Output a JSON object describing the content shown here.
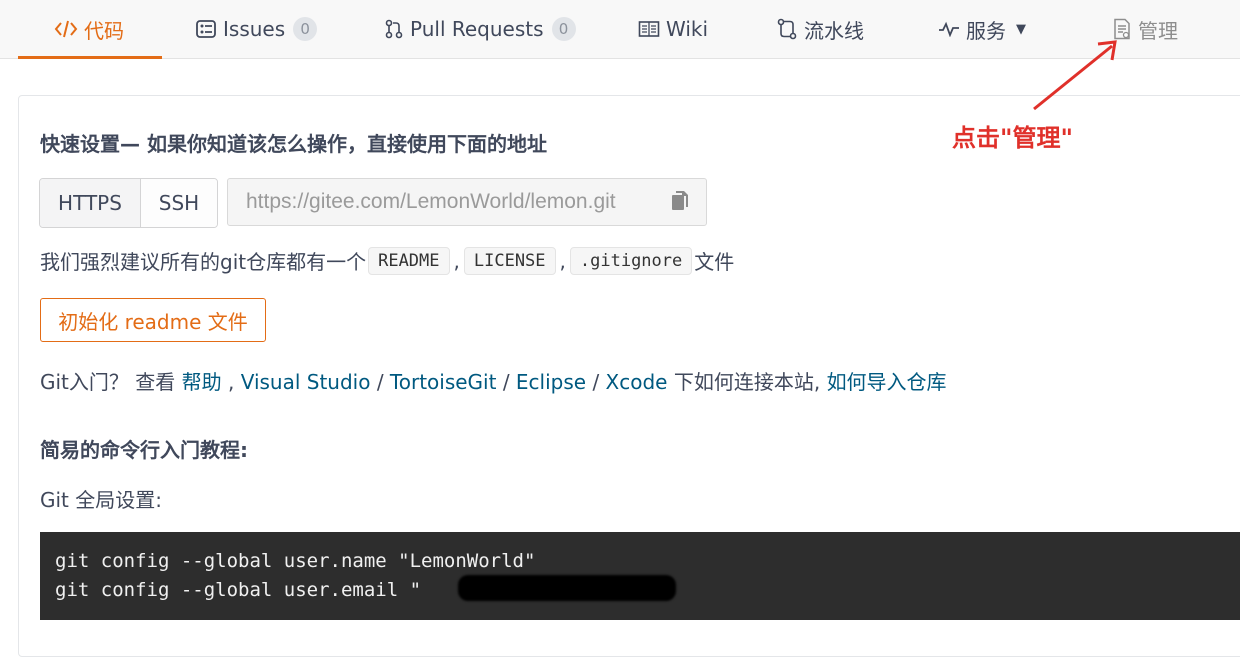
{
  "tabs": [
    {
      "label": "代码",
      "icon": "code-icon"
    },
    {
      "label": "Issues",
      "icon": "issues-icon",
      "count": "0"
    },
    {
      "label": "Pull Requests",
      "icon": "pull-request-icon",
      "count": "0"
    },
    {
      "label": "Wiki",
      "icon": "book-icon"
    },
    {
      "label": "流水线",
      "icon": "pipeline-icon"
    },
    {
      "label": "服务",
      "icon": "pulse-icon"
    },
    {
      "label": "管理",
      "icon": "document-icon"
    }
  ],
  "quick_setup": {
    "title": "快速设置— 如果你知道该怎么操作，直接使用下面的地址",
    "https_label": "HTTPS",
    "ssh_label": "SSH",
    "url": "https://gitee.com/LemonWorld/lemon.git",
    "copy_icon": "copy-icon"
  },
  "recommend": {
    "prefix": "我们强烈建议所有的git仓库都有一个",
    "files": [
      "README",
      "LICENSE",
      ".gitignore"
    ],
    "separator": ",",
    "suffix": "文件"
  },
  "init_button": "初始化 readme 文件",
  "help": {
    "prefix": "Git入门？ 查看 ",
    "help_link": "帮助",
    "tools": [
      "Visual Studio",
      "TortoiseGit",
      "Eclipse",
      "Xcode"
    ],
    "middle": " 下如何连接本站, ",
    "import_link": "如何导入仓库"
  },
  "tutorial": {
    "title": "简易的命令行入门教程:",
    "global_label": "Git 全局设置:",
    "code_lines": [
      "git config --global user.name \"LemonWorld\"",
      "git config --global user.email \""
    ]
  },
  "annotation": {
    "text": "点击\"管理\"",
    "color": "#e0302a"
  },
  "colors": {
    "accent": "#e36c16",
    "link": "#005980",
    "code_bg": "#2d2d2d"
  }
}
